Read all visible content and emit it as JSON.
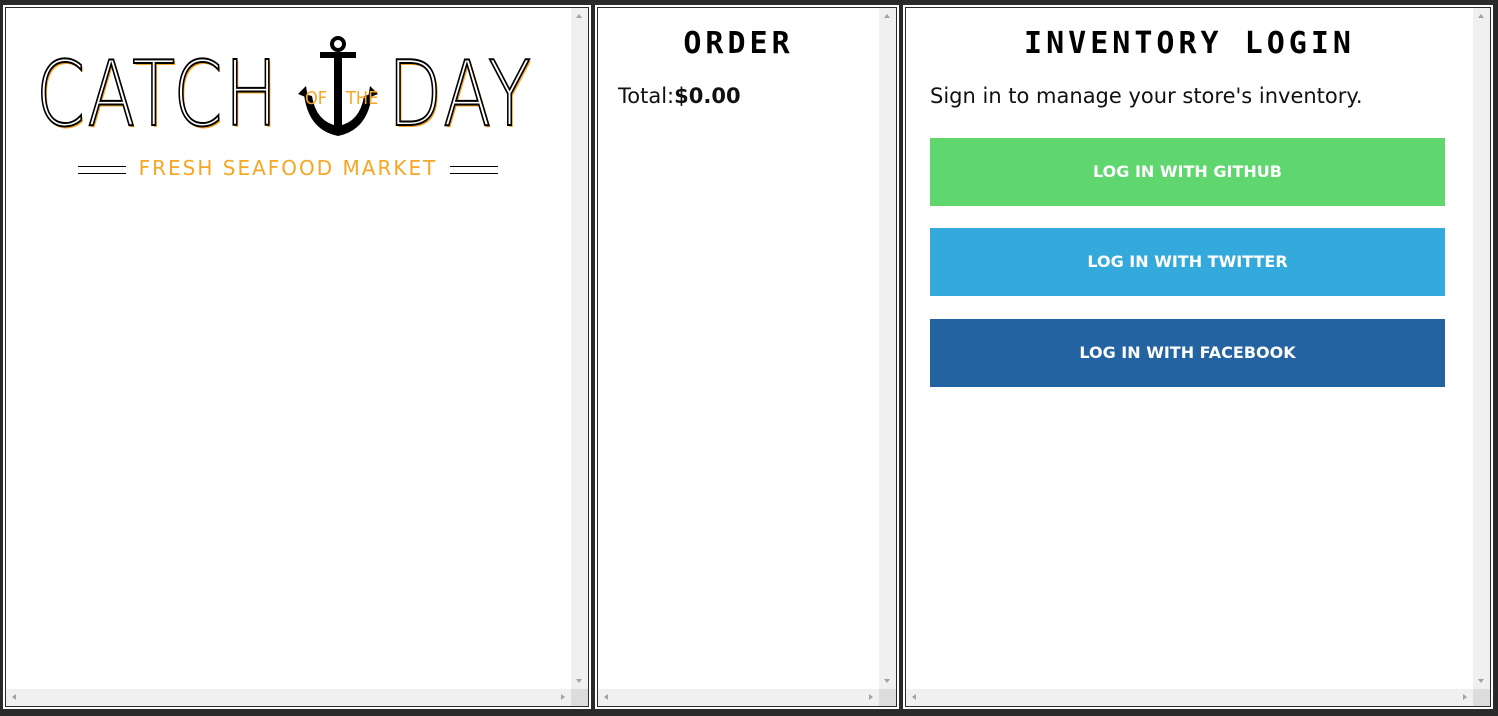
{
  "menu": {
    "logo": {
      "word_left": "CATCH",
      "word_of": "OF",
      "word_the": "THE",
      "word_right": "DAY",
      "tagline": "FRESH SEAFOOD MARKET",
      "icon": "anchor-icon"
    }
  },
  "order": {
    "title": "ORDER",
    "total_label": "Total:",
    "total_value": "$0.00"
  },
  "inventory": {
    "title": "INVENTORY LOGIN",
    "description": "Sign in to manage your store's inventory.",
    "buttons": [
      {
        "label": "LOG IN WITH GITHUB"
      },
      {
        "label": "LOG IN WITH TWITTER"
      },
      {
        "label": "LOG IN WITH FACEBOOK"
      }
    ]
  },
  "colors": {
    "background": "#2a2a2a",
    "accent_orange": "#f5a623",
    "github": "#5fd66e",
    "twitter": "#34a9dc",
    "facebook": "#2463a1"
  }
}
